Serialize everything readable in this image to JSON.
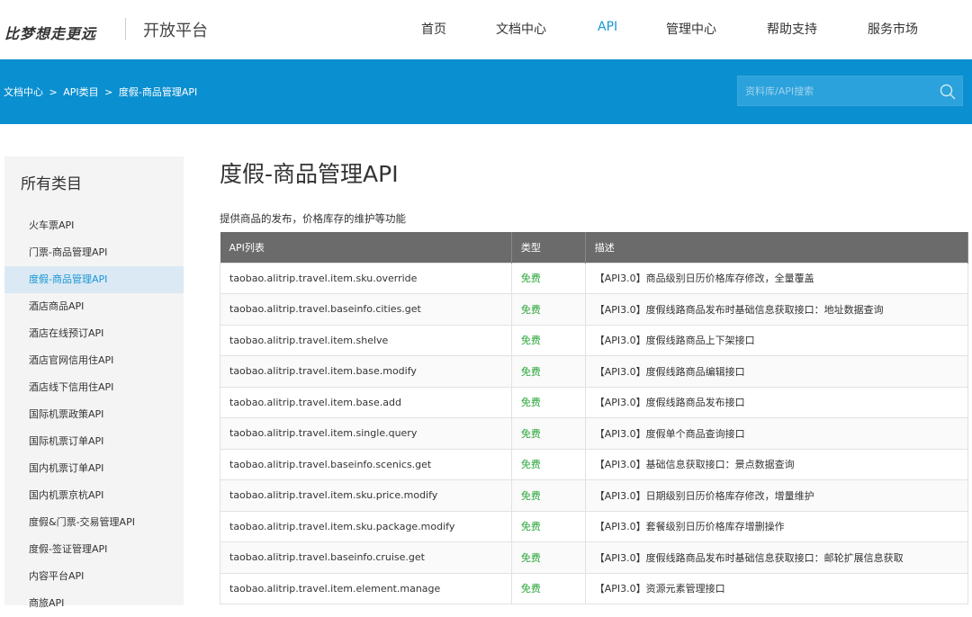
{
  "header": {
    "logo": "比梦想走更远",
    "platform": "开放平台",
    "nav": [
      "首页",
      "文档中心",
      "API",
      "管理中心",
      "帮助支持",
      "服务市场"
    ],
    "active_nav": "API"
  },
  "banner": {
    "breadcrumb": [
      "文档中心",
      ">",
      "API类目",
      ">",
      "度假-商品管理API"
    ],
    "search_placeholder": "资料库/API搜索"
  },
  "sidebar": {
    "title": "所有类目",
    "items": [
      "火车票API",
      "门票-商品管理API",
      "度假-商品管理API",
      "酒店商品API",
      "酒店在线预订API",
      "酒店官网信用住API",
      "酒店线下信用住API",
      "国际机票政策API",
      "国际机票订单API",
      "国内机票订单API",
      "国内机票京杭API",
      "度假&门票-交易管理API",
      "度假-签证管理API",
      "内容平台API",
      "商旅API"
    ],
    "active_item": "度假-商品管理API"
  },
  "main": {
    "title": "度假-商品管理API",
    "description": "提供商品的发布，价格库存的维护等功能",
    "columns": [
      "API列表",
      "类型",
      "描述"
    ],
    "rows": [
      [
        "taobao.alitrip.travel.item.sku.override",
        "免费",
        "【API3.0】商品级别日历价格库存修改，全量覆盖"
      ],
      [
        "taobao.alitrip.travel.baseinfo.cities.get",
        "免费",
        "【API3.0】度假线路商品发布时基础信息获取接口：地址数据查询"
      ],
      [
        "taobao.alitrip.travel.item.shelve",
        "免费",
        "【API3.0】度假线路商品上下架接口"
      ],
      [
        "taobao.alitrip.travel.item.base.modify",
        "免费",
        "【API3.0】度假线路商品编辑接口"
      ],
      [
        "taobao.alitrip.travel.item.base.add",
        "免费",
        "【API3.0】度假线路商品发布接口"
      ],
      [
        "taobao.alitrip.travel.item.single.query",
        "免费",
        "【API3.0】度假单个商品查询接口"
      ],
      [
        "taobao.alitrip.travel.baseinfo.scenics.get",
        "免费",
        "【API3.0】基础信息获取接口：景点数据查询"
      ],
      [
        "taobao.alitrip.travel.item.sku.price.modify",
        "免费",
        "【API3.0】日期级别日历价格库存修改，增量维护"
      ],
      [
        "taobao.alitrip.travel.item.sku.package.modify",
        "免费",
        "【API3.0】套餐级别日历价格库存增删操作"
      ],
      [
        "taobao.alitrip.travel.baseinfo.cruise.get",
        "免费",
        "【API3.0】度假线路商品发布时基础信息获取接口：邮轮扩展信息获取"
      ],
      [
        "taobao.alitrip.travel.item.element.manage",
        "免费",
        "【API3.0】资源元素管理接口"
      ]
    ]
  },
  "colors": {
    "banner": "#0a8fd0",
    "active": "#1a96d4",
    "free": "#2aa63a",
    "table_header": "#6b6b6b"
  }
}
